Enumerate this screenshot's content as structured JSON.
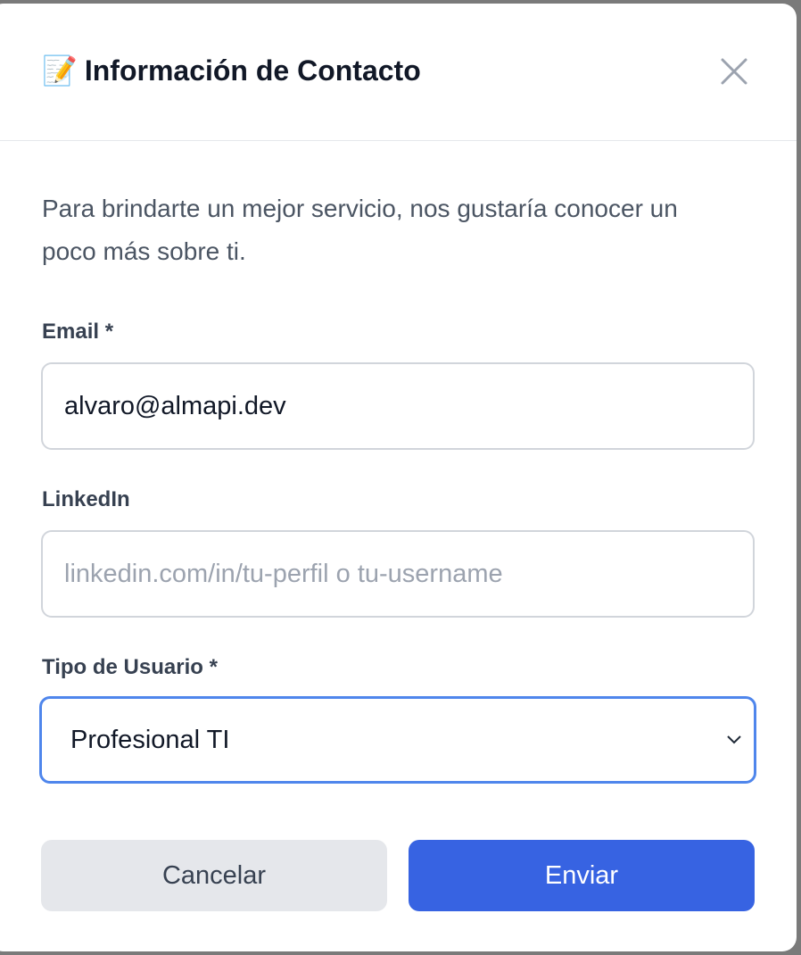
{
  "modal": {
    "title_icon": "memo-emoji",
    "title_emoji": "📝",
    "title": "Información de Contacto",
    "description": "Para brindarte un mejor servicio, nos gustaría conocer un poco más sobre ti.",
    "email": {
      "label": "Email *",
      "value": "alvaro@almapi.dev"
    },
    "linkedin": {
      "label": "LinkedIn",
      "value": "",
      "placeholder": "linkedin.com/in/tu-perfil o tu-username"
    },
    "user_type": {
      "label": "Tipo de Usuario *",
      "selected": "Profesional TI"
    },
    "cancel_label": "Cancelar",
    "submit_label": "Enviar",
    "colors": {
      "primary": "#3763e2",
      "focus_ring": "#4f86ec",
      "secondary": "#e5e7eb"
    }
  }
}
